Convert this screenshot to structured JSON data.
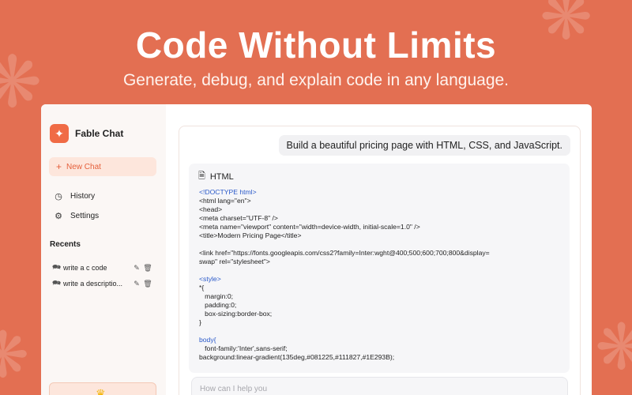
{
  "hero": {
    "title": "Code Without Limits",
    "subtitle": "Generate, debug, and explain code in any language."
  },
  "colors": {
    "background": "#e36f52",
    "accent": "#f06b45",
    "new_chat_bg": "#fde6dc",
    "code_keyword": "#2a59c9"
  },
  "sidebar": {
    "brand": {
      "name": "Fable Chat",
      "icon": "sparkle-icon"
    },
    "new_chat_label": "New Chat",
    "nav": [
      {
        "label": "History",
        "icon": "clock-icon"
      },
      {
        "label": "Settings",
        "icon": "gear-icon"
      }
    ],
    "recents_title": "Recents",
    "recents": [
      {
        "label": "write a c code"
      },
      {
        "label": "write a descriptio..."
      }
    ]
  },
  "chat": {
    "user_message": "Build a beautiful pricing page with HTML, CSS, and JavaScript.",
    "code_language": "HTML",
    "code_lines": [
      "<!DOCTYPE html>",
      "<html lang=\"en\">",
      "<head>",
      "<meta charset=\"UTF-8\" />",
      "<meta name=\"viewport\" content=\"width=device-width, initial-scale=1.0\" />",
      "<title>Modern Pricing Page</title>",
      "",
      "<link href=\"https://fonts.googleapis.com/css2?family=Inter:wght@400;500;600;700;800&display=",
      "swap\" rel=\"stylesheet\">",
      "",
      "<style>",
      "*{",
      "   margin:0;",
      "   padding:0;",
      "   box-sizing:border-box;",
      "}",
      "",
      "body{",
      "   font-family:'Inter',sans-serif;",
      "background:linear-gradient(135deg,#081225,#111827,#1E293B);"
    ],
    "input_placeholder": "How can I help you"
  }
}
